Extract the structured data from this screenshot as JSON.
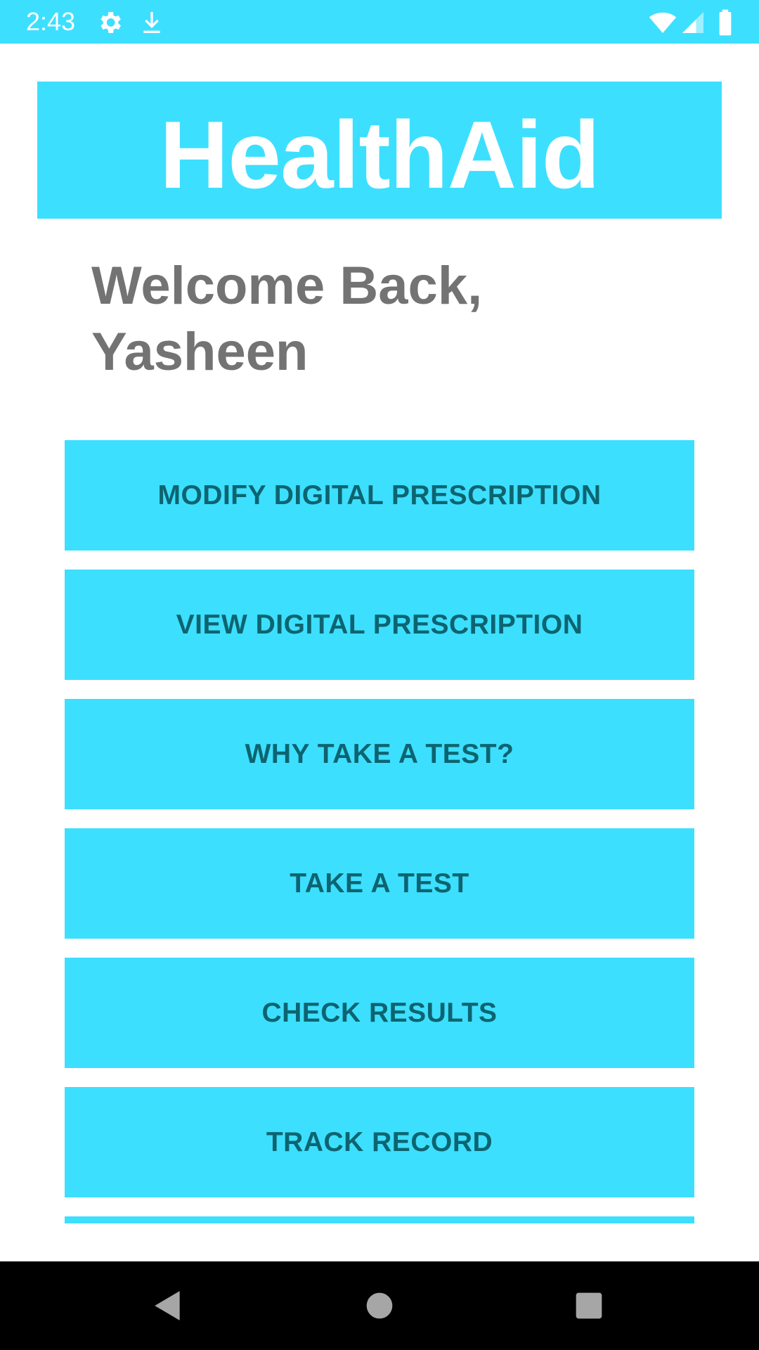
{
  "status_bar": {
    "time": "2:43",
    "icons": [
      "gear-icon",
      "download-icon",
      "wifi-icon",
      "signal-icon",
      "battery-icon"
    ]
  },
  "header": {
    "title": "HealthAid"
  },
  "welcome": {
    "line1": "Welcome Back,",
    "line2": "Yasheen"
  },
  "menu": {
    "items": [
      {
        "label": "MODIFY DIGITAL PRESCRIPTION"
      },
      {
        "label": "VIEW DIGITAL PRESCRIPTION"
      },
      {
        "label": "WHY TAKE A TEST?"
      },
      {
        "label": "TAKE A TEST"
      },
      {
        "label": "CHECK RESULTS"
      },
      {
        "label": "TRACK RECORD"
      }
    ]
  },
  "nav_bar": {
    "buttons": [
      "back-icon",
      "home-icon",
      "recents-icon"
    ]
  },
  "colors": {
    "accent": "#3ddfff",
    "button_text": "#0d6470",
    "welcome_text": "#737373"
  }
}
